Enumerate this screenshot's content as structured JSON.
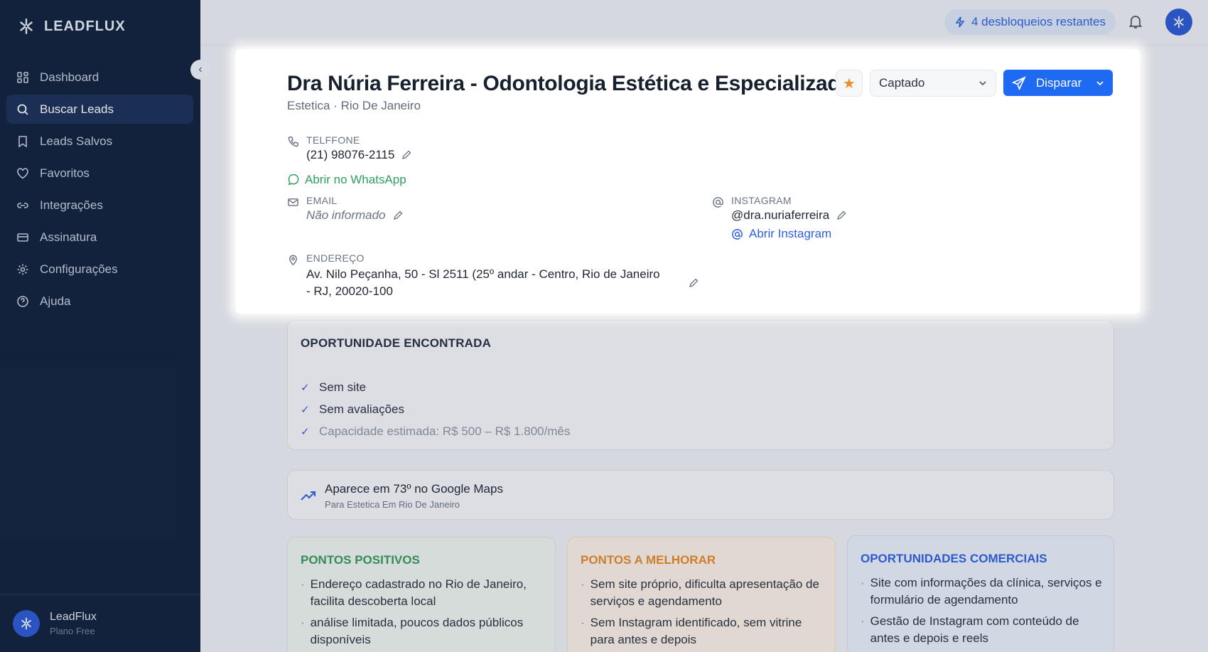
{
  "brand": {
    "name": "LEADFLUX"
  },
  "sidebar": {
    "items": [
      {
        "label": "Dashboard",
        "icon": "grid-icon"
      },
      {
        "label": "Buscar Leads",
        "icon": "search-icon",
        "active": true
      },
      {
        "label": "Leads Salvos",
        "icon": "bookmark-icon"
      },
      {
        "label": "Favoritos",
        "icon": "heart-icon"
      },
      {
        "label": "Integrações",
        "icon": "link-icon"
      },
      {
        "label": "Assinatura",
        "icon": "card-icon"
      },
      {
        "label": "Configurações",
        "icon": "gear-icon"
      },
      {
        "label": "Ajuda",
        "icon": "help-icon"
      }
    ],
    "footer": {
      "name": "LeadFlux",
      "plan": "Plano Free"
    }
  },
  "topbar": {
    "unlocks": "4 desbloqueios restantes"
  },
  "lead": {
    "name": "Dra Núria Ferreira - Odontologia Estética e Especializada",
    "subtitle": "Estetica · Rio De Janeiro",
    "status": "Captado",
    "send_label": "Disparar",
    "phone_label": "TELFFONE",
    "phone": "(21) 98076-2115",
    "whatsapp_link": "Abrir no WhatsApp",
    "email_label": "EMAIL",
    "email": "Não informado",
    "instagram_label": "INSTAGRAM",
    "instagram": "@dra.nuriaferreira",
    "instagram_link": "Abrir Instagram",
    "address_label": "ENDEREÇO",
    "address": "Av. Nilo Peçanha, 50 - Sl 2511 (25º andar - Centro, Rio de Janeiro - RJ, 20020-100"
  },
  "opportunity": {
    "title": "OPORTUNIDADE ENCONTRADA",
    "items": [
      "Sem site",
      "Sem avaliações",
      "Capacidade estimada: R$ 500 – R$ 1.800/mês"
    ]
  },
  "ranking": {
    "title": "Aparece em 73º no Google Maps",
    "subtitle": "Para Estetica Em Rio De Janeiro"
  },
  "columns": {
    "positive": {
      "title": "PONTOS POSITIVOS",
      "items": [
        "Endereço cadastrado no Rio de Janeiro, facilita descoberta local",
        "análise limitada, poucos dados públicos disponíveis"
      ]
    },
    "improve": {
      "title": "PONTOS A MELHORAR",
      "items": [
        "Sem site próprio, dificulta apresentação de serviços e agendamento",
        "Sem Instagram identificado, sem vitrine para antes e depois"
      ]
    },
    "commercial": {
      "title": "OPORTUNIDADES COMERCIAIS",
      "items": [
        "Site com informações da clínica, serviços e formulário de agendamento",
        "Gestão de Instagram com conteúdo de antes e depois e reels"
      ]
    }
  },
  "colors": {
    "sidebar_bg": "#11213d",
    "accent": "#1f6af2",
    "positive": "#3a9a5c",
    "improve": "#e58a2e",
    "star": "#ef8a2a"
  }
}
